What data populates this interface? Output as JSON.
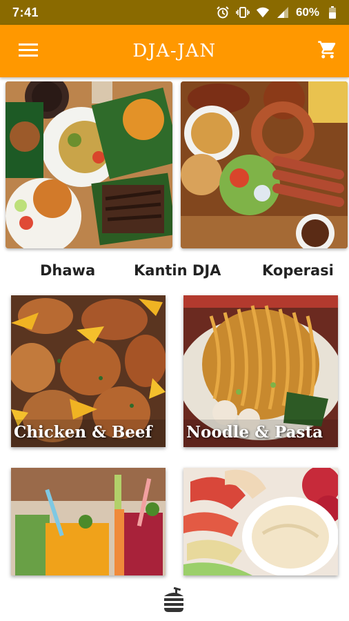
{
  "status_bar": {
    "time": "7:41",
    "battery": "60%",
    "icons": [
      "alarm-icon",
      "vibrate-icon",
      "wifi-icon",
      "signal-icon",
      "battery-icon"
    ]
  },
  "app_bar": {
    "title": "DJA-JAN",
    "background": "#ff9800",
    "menu_icon": "menu-icon",
    "cart_icon": "cart-icon"
  },
  "places": [
    {
      "label": "Dhawa"
    },
    {
      "label": "Kantin DJA"
    },
    {
      "label": "Koperasi"
    }
  ],
  "categories": [
    {
      "label": "Chicken & Beef"
    },
    {
      "label": "Noodle & Pasta"
    },
    {
      "label": ""
    },
    {
      "label": ""
    }
  ],
  "bottom_nav": {
    "icon": "food-icon"
  }
}
